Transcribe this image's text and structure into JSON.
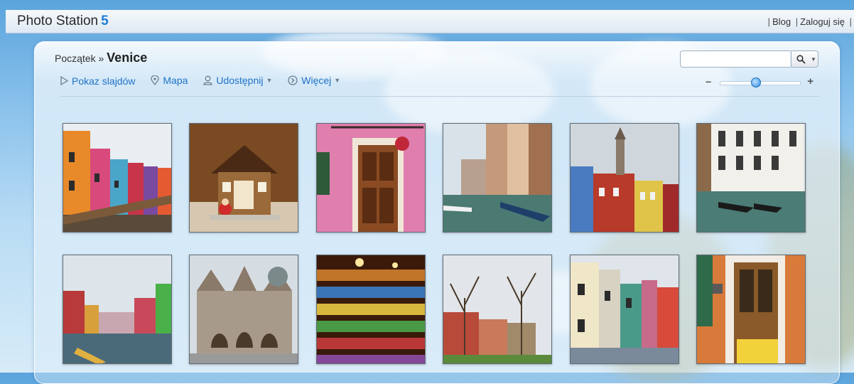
{
  "app": {
    "name": "Photo Station",
    "version": "5"
  },
  "top_links": {
    "blog": "Blog",
    "login": "Zaloguj się",
    "separator": "|"
  },
  "breadcrumb": {
    "home": "Początek",
    "separator": "»",
    "current": "Venice"
  },
  "toolbar": {
    "slideshow": "Pokaz slajdów",
    "map": "Mapa",
    "share": "Udostępnij",
    "more": "Więcej"
  },
  "search": {
    "value": "",
    "placeholder": ""
  },
  "zoom": {
    "level": 0.45
  },
  "photos": [
    {
      "subject": "colorful houses along canal"
    },
    {
      "subject": "gingerbread house with santa"
    },
    {
      "subject": "pink wall with wooden door"
    },
    {
      "subject": "canal with boats"
    },
    {
      "subject": "red house and bell tower"
    },
    {
      "subject": "gondolas in front of white palazzo"
    },
    {
      "subject": "canal with colorful houses"
    },
    {
      "subject": "St Mark's Basilica"
    },
    {
      "subject": "murano glass beads"
    },
    {
      "subject": "bare trees by houses"
    },
    {
      "subject": "row of pastel houses"
    },
    {
      "subject": "orange house with wooden door"
    }
  ],
  "colors": {
    "accent": "#1f73c6",
    "logo_five": "#1d7fd6"
  }
}
